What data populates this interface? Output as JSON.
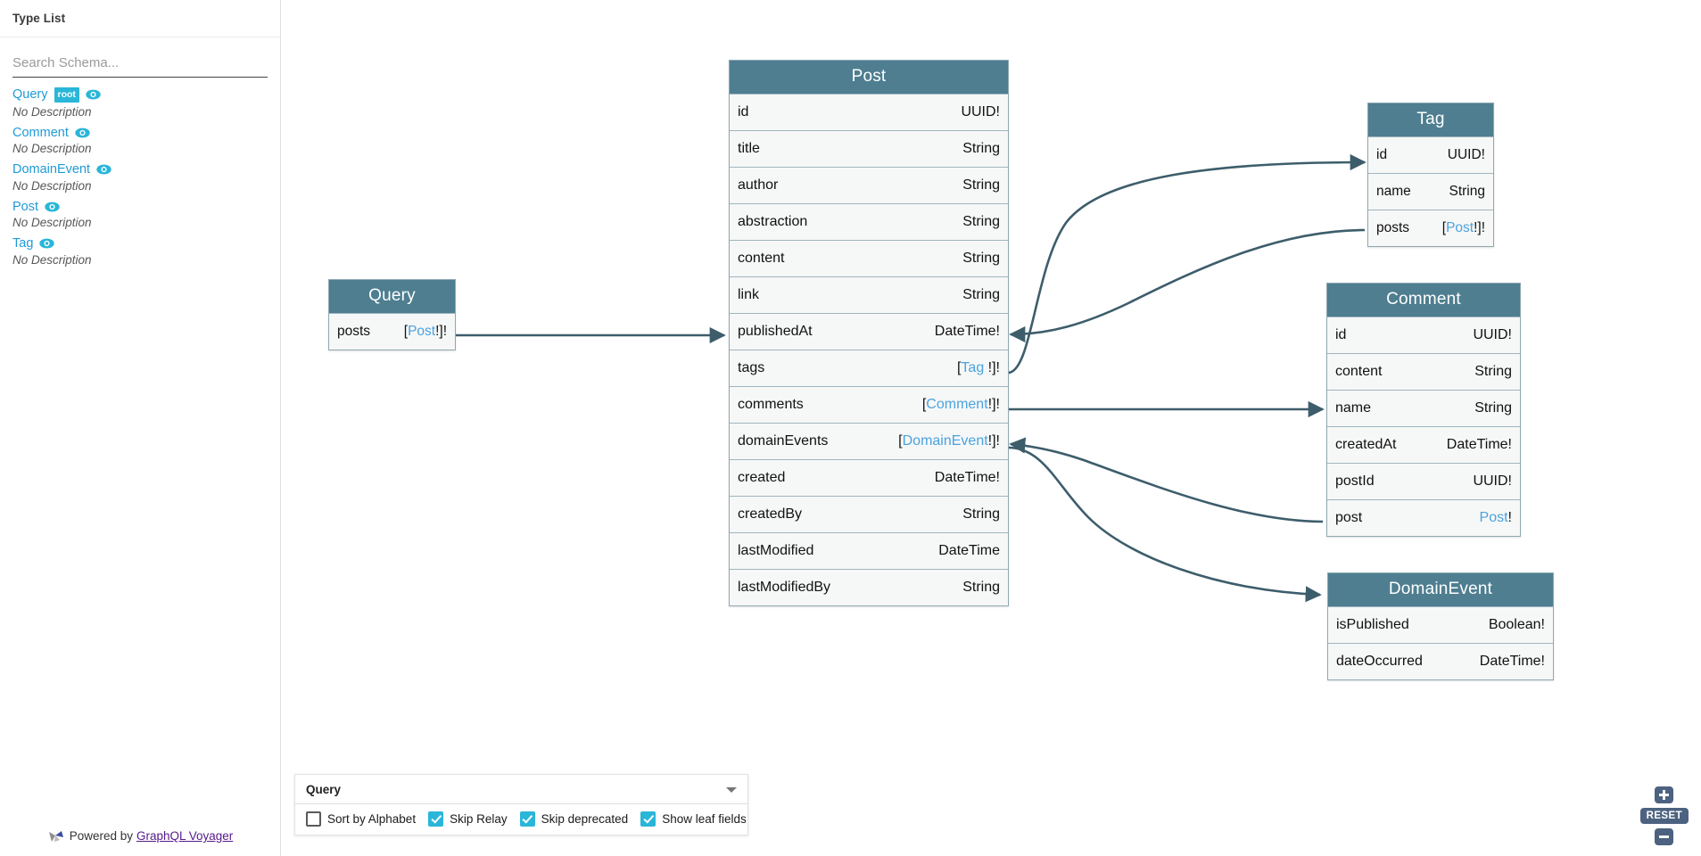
{
  "sidebar": {
    "header_title": "Type List",
    "search": {
      "placeholder": "Search Schema...",
      "value": ""
    },
    "types": [
      {
        "name": "Query",
        "badge": "root",
        "description": "No Description"
      },
      {
        "name": "Comment",
        "badge": "",
        "description": "No Description"
      },
      {
        "name": "DomainEvent",
        "badge": "",
        "description": "No Description"
      },
      {
        "name": "Post",
        "badge": "",
        "description": "No Description"
      },
      {
        "name": "Tag",
        "badge": "",
        "description": "No Description"
      }
    ],
    "footer": {
      "prefix": "Powered by",
      "link_label": "GraphQL Voyager"
    }
  },
  "settings": {
    "selected_root": "Query",
    "checkboxes": [
      {
        "label": "Sort by Alphabet",
        "checked": false
      },
      {
        "label": "Skip Relay",
        "checked": true
      },
      {
        "label": "Skip deprecated",
        "checked": true
      },
      {
        "label": "Show leaf fields",
        "checked": true
      }
    ]
  },
  "zoom_controls": {
    "zoom_in_label": "+",
    "reset_label": "RESET",
    "zoom_out_label": "-"
  },
  "colors": {
    "node_header": "#4e7e90",
    "node_body": "#f6f7f7",
    "node_border": "#8fa9b3",
    "edge": "#3d5d6b",
    "type_link": "#1f9ad6",
    "ref_link": "#4aa3df",
    "accent_cyan": "#29b6d8",
    "zoom_button": "#4c6280"
  },
  "graph": {
    "nodes": [
      {
        "id": "query",
        "title": "Query",
        "fields": [
          {
            "name": "posts",
            "type_prefix": "[",
            "type_ref": "Post",
            "type_suffix": "!]!"
          }
        ]
      },
      {
        "id": "post",
        "title": "Post",
        "fields": [
          {
            "name": "id",
            "type_prefix": "",
            "type_ref": "",
            "type_suffix": "",
            "type_plain": "UUID!"
          },
          {
            "name": "title",
            "type_plain": "String"
          },
          {
            "name": "author",
            "type_plain": "String"
          },
          {
            "name": "abstraction",
            "type_plain": "String"
          },
          {
            "name": "content",
            "type_plain": "String"
          },
          {
            "name": "link",
            "type_plain": "String"
          },
          {
            "name": "publishedAt",
            "type_plain": "DateTime!"
          },
          {
            "name": "tags",
            "type_prefix": "[",
            "type_ref": "Tag",
            "type_suffix": " !]!"
          },
          {
            "name": "comments",
            "type_prefix": "[",
            "type_ref": "Comment",
            "type_suffix": "!]!"
          },
          {
            "name": "domainEvents",
            "type_prefix": "[",
            "type_ref": "DomainEvent",
            "type_suffix": "!]!"
          },
          {
            "name": "created",
            "type_plain": "DateTime!"
          },
          {
            "name": "createdBy",
            "type_plain": "String"
          },
          {
            "name": "lastModified",
            "type_plain": "DateTime"
          },
          {
            "name": "lastModifiedBy",
            "type_plain": "String"
          }
        ]
      },
      {
        "id": "tag",
        "title": "Tag",
        "fields": [
          {
            "name": "id",
            "type_plain": "UUID!"
          },
          {
            "name": "name",
            "type_plain": "String"
          },
          {
            "name": "posts",
            "type_prefix": "[",
            "type_ref": "Post",
            "type_suffix": "!]!"
          }
        ]
      },
      {
        "id": "comment",
        "title": "Comment",
        "fields": [
          {
            "name": "id",
            "type_plain": "UUID!"
          },
          {
            "name": "content",
            "type_plain": "String"
          },
          {
            "name": "name",
            "type_plain": "String"
          },
          {
            "name": "createdAt",
            "type_plain": "DateTime!"
          },
          {
            "name": "postId",
            "type_plain": "UUID!"
          },
          {
            "name": "post",
            "type_prefix": "",
            "type_ref": "Post",
            "type_suffix": "!"
          }
        ]
      },
      {
        "id": "domainevent",
        "title": "DomainEvent",
        "fields": [
          {
            "name": "isPublished",
            "type_plain": "Boolean!"
          },
          {
            "name": "dateOccurred",
            "type_plain": "DateTime!"
          }
        ]
      }
    ],
    "edges": [
      {
        "from": "query.posts",
        "to": "post"
      },
      {
        "from": "post.tags",
        "to": "tag"
      },
      {
        "from": "tag.posts",
        "to": "post.publishedAt"
      },
      {
        "from": "post.comments",
        "to": "comment.name"
      },
      {
        "from": "comment.post",
        "to": "post.domainEvents"
      },
      {
        "from": "post.domainEvents",
        "to": "domainevent"
      }
    ]
  }
}
